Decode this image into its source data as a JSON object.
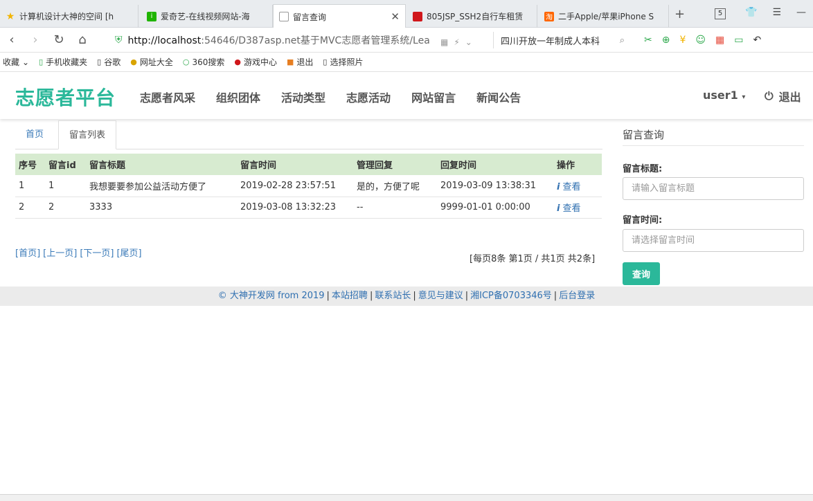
{
  "browser": {
    "tabs": [
      {
        "label": "计算机设计大神的空间 [h",
        "icon": "star-icon",
        "color": "#f2b400"
      },
      {
        "label": "爱奇艺-在线视频网站-海",
        "icon": "iqiyi-icon",
        "color": "#1fb400"
      },
      {
        "label": "留言查询",
        "icon": "page-icon",
        "color": "#999999"
      },
      {
        "label": "805JSP_SSH2自行车租赁",
        "icon": "red-square-icon",
        "color": "#d0171b"
      },
      {
        "label": "二手Apple/苹果iPhone S",
        "icon": "taobao-icon",
        "color": "#ff6600"
      }
    ],
    "tab_count": "5",
    "url_host": "http://localhost",
    "url_rest": ":54646/D387asp.net基于MVC志愿者管理系统/Lea",
    "search_text": "四川开放一年制成人本科",
    "bookmarks": [
      "收藏",
      "手机收藏夹",
      "谷歌",
      "网址大全",
      "360搜索",
      "游戏中心",
      "退出",
      "选择照片"
    ]
  },
  "header": {
    "brand": "志愿者平台",
    "nav": [
      "志愿者风采",
      "组织团体",
      "活动类型",
      "志愿活动",
      "网站留言",
      "新闻公告"
    ],
    "user": "user1",
    "logout": "退出"
  },
  "tabs": {
    "home": "首页",
    "current": "留言列表"
  },
  "table": {
    "headers": [
      "序号",
      "留言id",
      "留言标题",
      "留言时间",
      "管理回复",
      "回复时间",
      "操作"
    ],
    "rows": [
      {
        "no": "1",
        "id": "1",
        "title": "我想要要参加公益活动方便了",
        "time": "2019-02-28 23:57:51",
        "reply": "是的，方便了呢",
        "reply_time": "2019-03-09 13:38:31",
        "action": "查看"
      },
      {
        "no": "2",
        "id": "2",
        "title": "3333",
        "time": "2019-03-08 13:32:23",
        "reply": "--",
        "reply_time": "9999-01-01 0:00:00",
        "action": "查看"
      }
    ]
  },
  "pager": {
    "first": "[首页]",
    "prev": "[上一页]",
    "next": "[下一页]",
    "last": "[尾页]",
    "info": "[每页8条 第1页 / 共1页 共2条]"
  },
  "sidebar": {
    "title": "留言查询",
    "title_label": "留言标题:",
    "title_placeholder": "请输入留言标题",
    "time_label": "留言时间:",
    "time_placeholder": "请选择留言时间",
    "search_button": "查询"
  },
  "footer": {
    "links": [
      "© 大神开发网 from 2019",
      "本站招聘",
      "联系站长",
      "意见与建议",
      "湘ICP备0703346号",
      "后台登录"
    ]
  },
  "colors": {
    "brand": "#2bb89a",
    "table_header_bg": "#d7ebd0",
    "link": "#2f6fb0"
  }
}
